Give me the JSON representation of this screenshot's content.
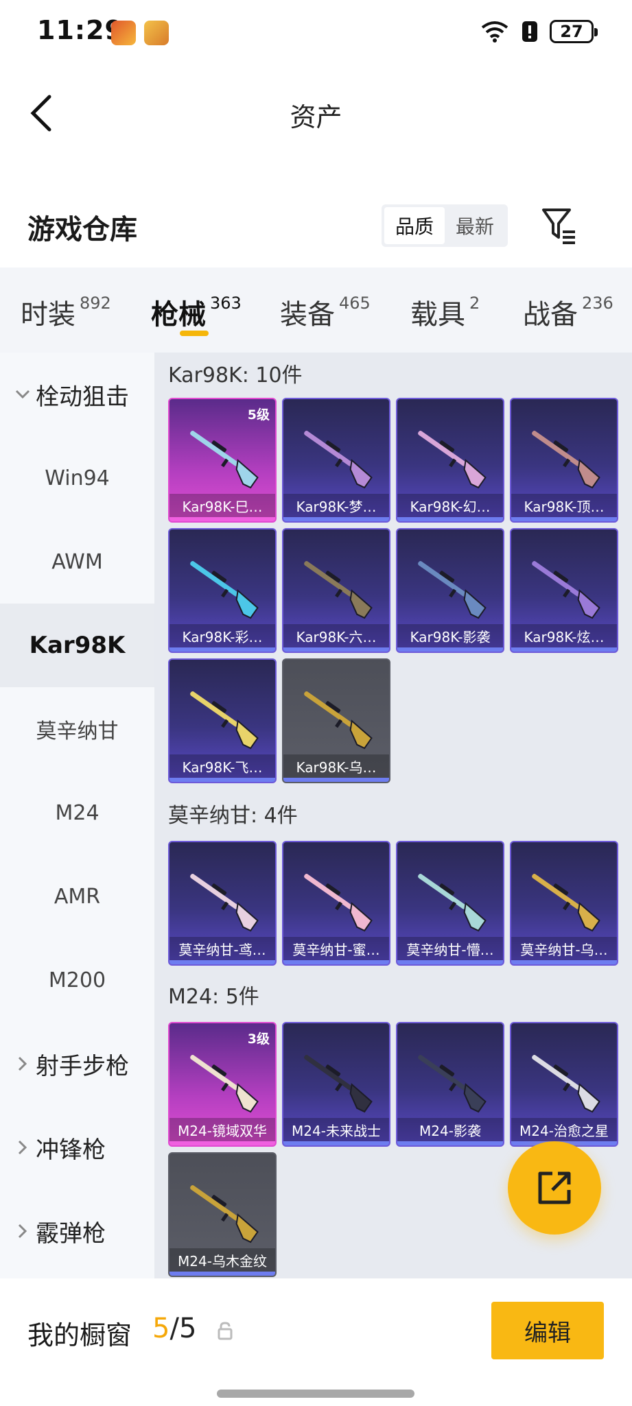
{
  "status_bar": {
    "time": "11:29",
    "battery": "27"
  },
  "header": {
    "title": "资产"
  },
  "warehouse": {
    "title": "游戏仓库",
    "sort_options": [
      "品质",
      "最新"
    ],
    "active_sort": "品质"
  },
  "category_tabs": [
    {
      "label": "时装",
      "count": "892"
    },
    {
      "label": "枪械",
      "count": "363"
    },
    {
      "label": "装备",
      "count": "465"
    },
    {
      "label": "载具",
      "count": "2"
    },
    {
      "label": "战备",
      "count": "236"
    }
  ],
  "active_category": "枪械",
  "sidebar": {
    "items": [
      {
        "label": "栓动狙击",
        "type": "group",
        "expanded": true
      },
      {
        "label": "Win94",
        "type": "item"
      },
      {
        "label": "AWM",
        "type": "item"
      },
      {
        "label": "Kar98K",
        "type": "item",
        "selected": true
      },
      {
        "label": "莫辛纳甘",
        "type": "item"
      },
      {
        "label": "M24",
        "type": "item"
      },
      {
        "label": "AMR",
        "type": "item"
      },
      {
        "label": "M200",
        "type": "item"
      },
      {
        "label": "射手步枪",
        "type": "group",
        "expanded": false
      },
      {
        "label": "冲锋枪",
        "type": "group",
        "expanded": false
      },
      {
        "label": "霰弹枪",
        "type": "group",
        "expanded": false
      }
    ]
  },
  "sections": [
    {
      "title": "Kar98K: 10件",
      "items": [
        {
          "name": "Kar98K-巳…",
          "rarity": "pink",
          "level": "5级",
          "gun_color": "#9fd5ea"
        },
        {
          "name": "Kar98K-梦…",
          "rarity": "purple",
          "gun_color": "#b58ad6"
        },
        {
          "name": "Kar98K-幻…",
          "rarity": "purple",
          "gun_color": "#d9a6d9"
        },
        {
          "name": "Kar98K-顶…",
          "rarity": "purple",
          "gun_color": "#c08c8c"
        },
        {
          "name": "Kar98K-彩…",
          "rarity": "purple",
          "gun_color": "#4cc7e8"
        },
        {
          "name": "Kar98K-六…",
          "rarity": "purple",
          "gun_color": "#8a7a5a"
        },
        {
          "name": "Kar98K-影袭",
          "rarity": "purple",
          "gun_color": "#6a8ac0"
        },
        {
          "name": "Kar98K-炫…",
          "rarity": "purple",
          "gun_color": "#9a7ad8"
        },
        {
          "name": "Kar98K-飞…",
          "rarity": "purple",
          "gun_color": "#e8d36a"
        },
        {
          "name": "Kar98K-乌…",
          "rarity": "gray",
          "gun_color": "#c9a33a"
        }
      ]
    },
    {
      "title": "莫辛纳甘: 4件",
      "items": [
        {
          "name": "莫辛纳甘-鸢…",
          "rarity": "purple",
          "gun_color": "#e8d0e0"
        },
        {
          "name": "莫辛纳甘-蜜…",
          "rarity": "purple",
          "gun_color": "#f0b8d0"
        },
        {
          "name": "莫辛纳甘-懵…",
          "rarity": "purple",
          "gun_color": "#a8d8d8"
        },
        {
          "name": "莫辛纳甘-乌…",
          "rarity": "purple",
          "gun_color": "#d8b04a"
        }
      ]
    },
    {
      "title": "M24: 5件",
      "items": [
        {
          "name": "M24-镜域双华",
          "rarity": "pink",
          "level": "3级",
          "gun_color": "#efe2d0"
        },
        {
          "name": "M24-未来战士",
          "rarity": "purple",
          "gun_color": "#303040"
        },
        {
          "name": "M24-影袭",
          "rarity": "purple",
          "gun_color": "#3a3f58"
        },
        {
          "name": "M24-治愈之星",
          "rarity": "purple",
          "gun_color": "#dcdce4"
        },
        {
          "name": "M24-乌木金纹",
          "rarity": "gray",
          "gun_color": "#c9a33a"
        }
      ]
    }
  ],
  "bottom_bar": {
    "label": "我的橱窗",
    "count_current": "5",
    "count_sep": "/",
    "count_total": "5",
    "edit_label": "编辑"
  },
  "colors": {
    "accent": "#f9b813",
    "tab_underline": "#f5b60a",
    "rarity_purple": "#3a3580",
    "rarity_pink": "#b43fc0",
    "rarity_gray": "#55575f"
  },
  "icons": {
    "back": "chevron-left-icon",
    "filter": "filter-icon",
    "fab": "share-icon",
    "lock": "lock-icon"
  }
}
